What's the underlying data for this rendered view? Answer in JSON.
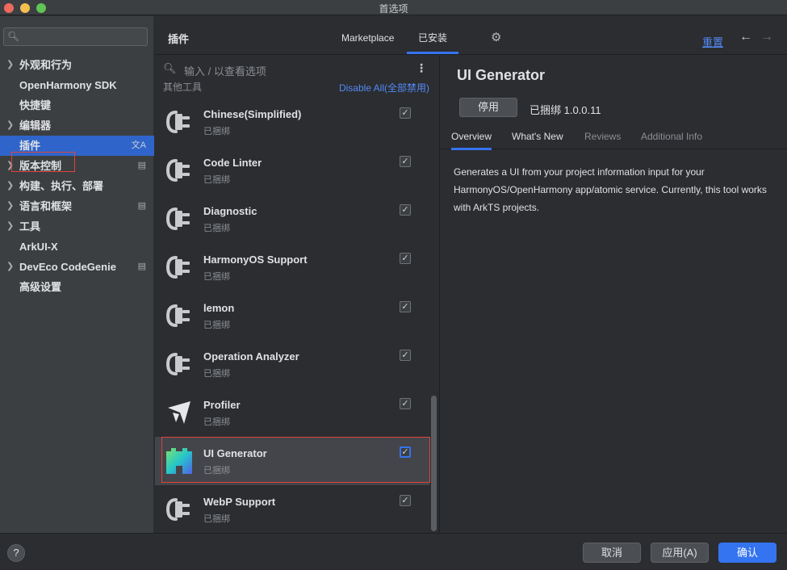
{
  "window": {
    "title": "首选项"
  },
  "sidebar": {
    "search_placeholder": "",
    "items": [
      {
        "label": "外观和行为",
        "has_arrow": true
      },
      {
        "label": "OpenHarmony SDK",
        "has_arrow": false
      },
      {
        "label": "快捷键",
        "has_arrow": false
      },
      {
        "label": "编辑器",
        "has_arrow": true
      },
      {
        "label": "插件",
        "has_arrow": false,
        "active": true
      },
      {
        "label": "版本控制",
        "has_arrow": true
      },
      {
        "label": "构建、执行、部署",
        "has_arrow": true
      },
      {
        "label": "语言和框架",
        "has_arrow": true
      },
      {
        "label": "工具",
        "has_arrow": true
      },
      {
        "label": "ArkUI-X",
        "has_arrow": false
      },
      {
        "label": "DevEco CodeGenie",
        "has_arrow": true
      },
      {
        "label": "高级设置",
        "has_arrow": false
      }
    ]
  },
  "header": {
    "title": "插件",
    "tabs": [
      {
        "label": "Marketplace"
      },
      {
        "label": "已安装",
        "active": true
      }
    ],
    "reset_label": "重置"
  },
  "list": {
    "search_placeholder": "输入 / 以查看选项",
    "group_name": "其他工具",
    "group_disable_all": "Disable All(全部禁用)",
    "plugins": [
      {
        "name": "Chinese(Simplified)",
        "status": "已捆绑",
        "enabled": true,
        "icon": "plug-icon"
      },
      {
        "name": "Code Linter",
        "status": "已捆绑",
        "enabled": true,
        "icon": "plug-icon"
      },
      {
        "name": "Diagnostic",
        "status": "已捆绑",
        "enabled": true,
        "icon": "plug-icon"
      },
      {
        "name": "HarmonyOS Support",
        "status": "已捆绑",
        "enabled": true,
        "icon": "plug-icon"
      },
      {
        "name": "lemon",
        "status": "已捆绑",
        "enabled": true,
        "icon": "plug-icon"
      },
      {
        "name": "Operation Analyzer",
        "status": "已捆绑",
        "enabled": true,
        "icon": "plug-icon"
      },
      {
        "name": "Profiler",
        "status": "已捆绑",
        "enabled": true,
        "icon": "profiler-icon"
      },
      {
        "name": "UI Generator",
        "status": "已捆绑",
        "enabled": true,
        "icon": "ui-generator-icon",
        "selected": true
      },
      {
        "name": "WebP Support",
        "status": "已捆绑",
        "enabled": true,
        "icon": "plug-icon"
      }
    ]
  },
  "detail": {
    "title": "UI Generator",
    "disable_label": "停用",
    "version": "已捆绑 1.0.0.11",
    "tabs": [
      {
        "label": "Overview",
        "active": true
      },
      {
        "label": "What's New"
      },
      {
        "label": "Reviews"
      },
      {
        "label": "Additional Info"
      }
    ],
    "description": "Generates a UI from your project information input for your HarmonyOS/OpenHarmony app/atomic service. Currently, this tool works with ArkTS projects."
  },
  "footer": {
    "help_label": "?",
    "cancel_label": "取消",
    "apply_label": "应用(A)",
    "ok_label": "确认"
  },
  "colors": {
    "accent": "#3574f0",
    "selection_outline": "#e0433d",
    "link": "#548af7"
  }
}
